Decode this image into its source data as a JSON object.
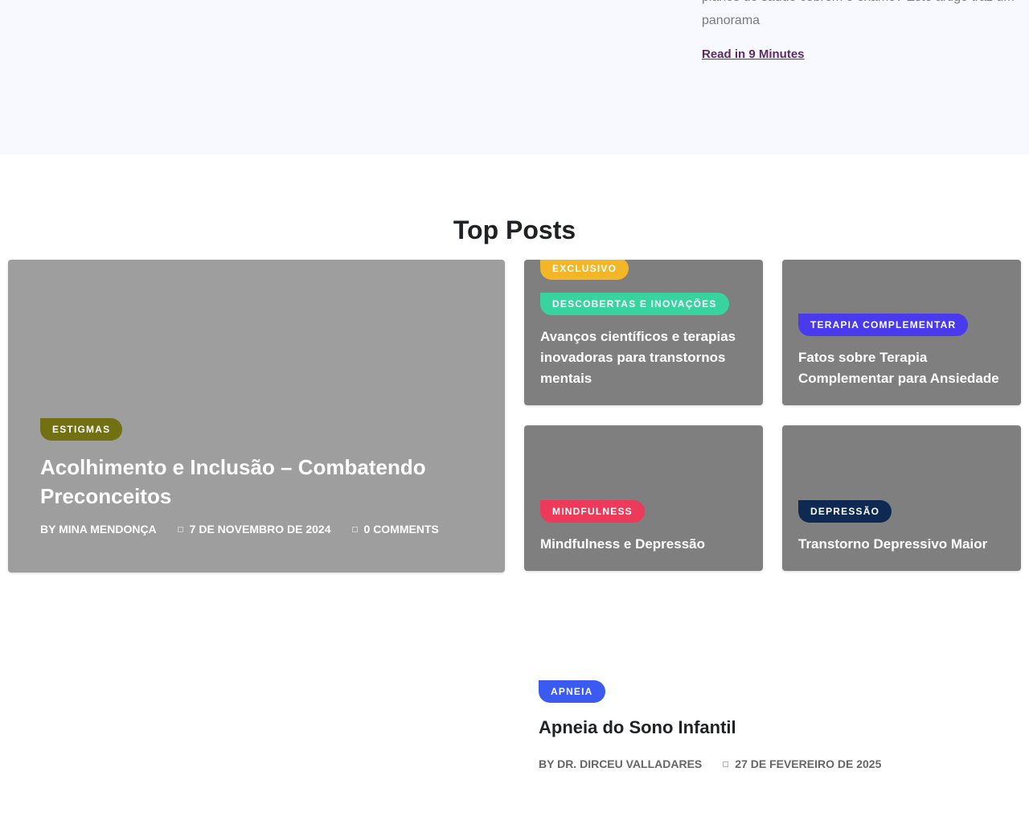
{
  "hero": {
    "excerpt": "planos de saúde cobrem o exame? Este artigo traz um\npanorama",
    "read_more": "Read in 9 Minutes"
  },
  "top_posts": {
    "title": "Top Posts",
    "featured": {
      "category": "Estigmas",
      "category_color": "#717013",
      "title": "Acolhimento e Inclusão – Combatendo Preconceitos",
      "author": "BY MINA MENDONÇA",
      "date": "7 DE NOVEMBRO DE 2024",
      "comments": "0 COMMENTS",
      "date_icon": "calendar-icon",
      "comments_icon": "comment-icon"
    },
    "cards": [
      {
        "categories": [
          {
            "label": "Exclusivo",
            "color": "#f3b626"
          },
          {
            "label": "Descobertas e Inovações",
            "color": "#38d39f"
          }
        ],
        "title": "Avanços científicos e terapias inovadoras para transtornos mentais"
      },
      {
        "categories": [
          {
            "label": "Terapia Complementar",
            "color": "#4a3aee"
          }
        ],
        "title": "Fatos sobre Terapia Complementar para Ansiedade"
      },
      {
        "categories": [
          {
            "label": "Mindfulness",
            "color": "#ee3a5a"
          }
        ],
        "title": "Mindfulness e Depressão"
      },
      {
        "categories": [
          {
            "label": "Depressão",
            "color": "#0e2a52"
          }
        ],
        "title": "Transtorno Depressivo Maior"
      }
    ]
  },
  "post_row": {
    "category": "Apneia",
    "category_color": "#3a5af0",
    "title": "Apneia do Sono Infantil",
    "author": "BY DR. DIRCEU VALLADARES",
    "date": "27 DE FEVEREIRO DE 2025",
    "date_icon": "calendar-icon"
  }
}
